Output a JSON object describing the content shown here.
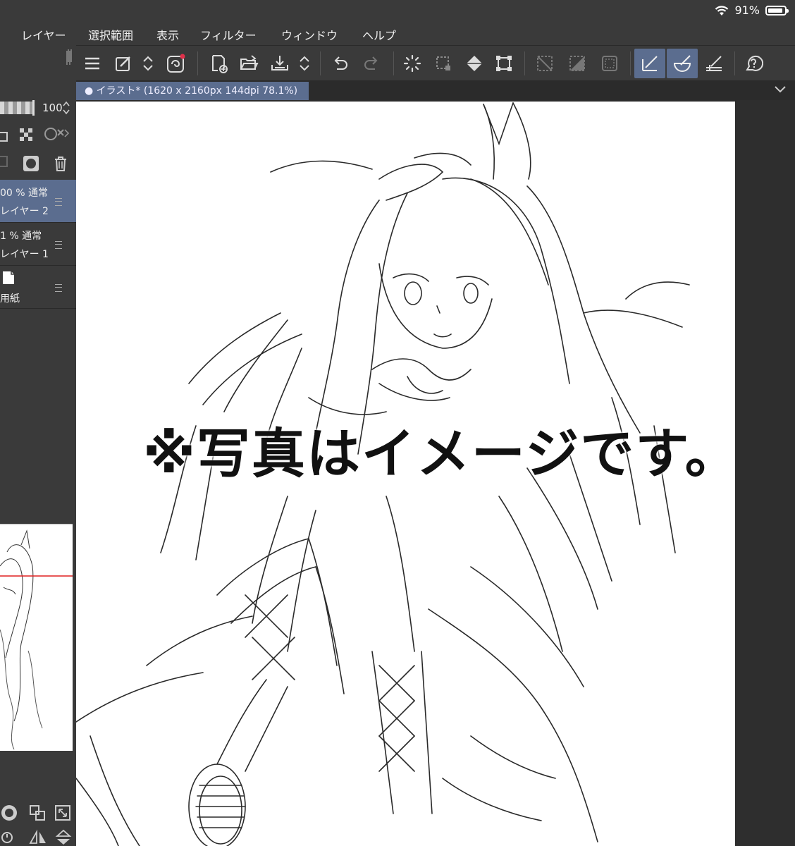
{
  "status": {
    "wifi_icon": "wifi-icon",
    "battery": "91%",
    "battery_level": 0.91
  },
  "menu": {
    "items": [
      "レイヤー",
      "選択範囲",
      "表示",
      "フィルター",
      "ウィンドウ",
      "ヘルプ"
    ]
  },
  "toolbar": {
    "icons": [
      "menu-icon",
      "eyedropper-icon",
      "up-down-icon",
      "swirl-icon",
      "new-file-icon",
      "open-folder-icon",
      "save-icon",
      "up-down-icon",
      "undo-icon",
      "redo-icon",
      "sparkle-loader-icon",
      "selection-icon",
      "fill-icon",
      "transform-icon",
      "clear-selection-icon",
      "invert-selection-icon",
      "border-icon",
      "ruler-snap-icon",
      "ruler-curve-icon",
      "ruler-grid-icon",
      "help-icon"
    ]
  },
  "layers": {
    "opacity": "100",
    "items": [
      {
        "mode": "00 % 通常",
        "name": "レイヤー 2",
        "selected": true
      },
      {
        "mode": "1 % 通常",
        "name": "レイヤー 1",
        "selected": false
      },
      {
        "mode": "",
        "name": "用紙",
        "selected": false
      }
    ]
  },
  "document": {
    "tab_label": "● イラスト* (1620 x 2160px 144dpi 78.1%)"
  },
  "canvas": {
    "overlay_text": "※写真はイメージです。"
  },
  "colors": {
    "panel": "#3a3a3a",
    "accent": "#5b6d8f",
    "background": "#2b2b2b",
    "nav_red": "#e02020"
  }
}
